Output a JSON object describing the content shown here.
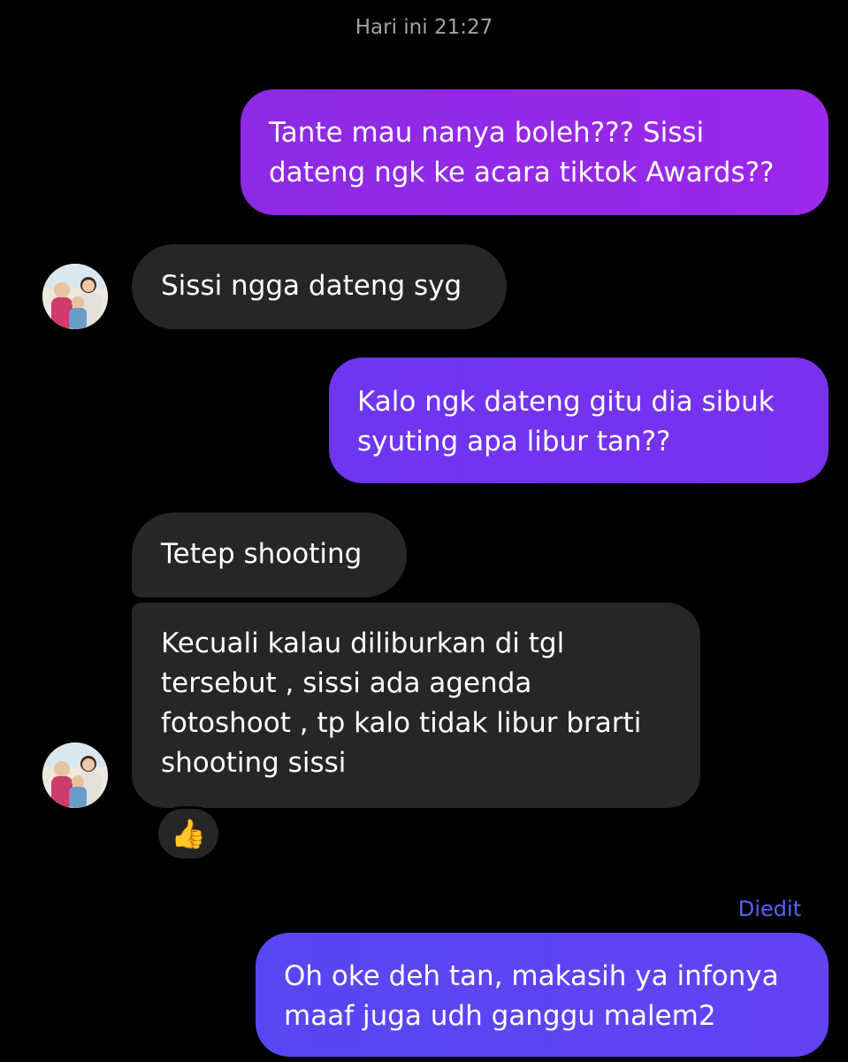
{
  "conversation": {
    "timestamp": "Hari ini 21:27",
    "edited_label": "Diedit",
    "reaction_emoji": "👍",
    "messages": [
      {
        "direction": "sent",
        "text": "Tante mau nanya boleh??? Sissi\ndateng ngk ke acara tiktok Awards??"
      },
      {
        "direction": "received",
        "text": "Sissi ngga dateng syg"
      },
      {
        "direction": "sent",
        "text": "Kalo ngk dateng gitu dia sibuk\nsyuting apa libur tan??"
      },
      {
        "direction": "received",
        "text": "Tetep shooting"
      },
      {
        "direction": "received",
        "text": "Kecuali kalau diliburkan di tgl\ntersebut , sissi ada agenda\nfotoshoot , tp kalo tidak libur brarti\nshooting sissi"
      },
      {
        "direction": "sent",
        "text": "Oh oke deh tan, makasih ya infonya\nmaaf juga udh ganggu malem2"
      }
    ]
  },
  "colors": {
    "background": "#000000",
    "received_bubble": "#262626",
    "sent_bubble_1": "#9128e8",
    "sent_bubble_2": "#7333f0",
    "sent_bubble_3": "#5d44f3",
    "edited_label": "#5a62ee",
    "timestamp": "#a3a3a3"
  }
}
